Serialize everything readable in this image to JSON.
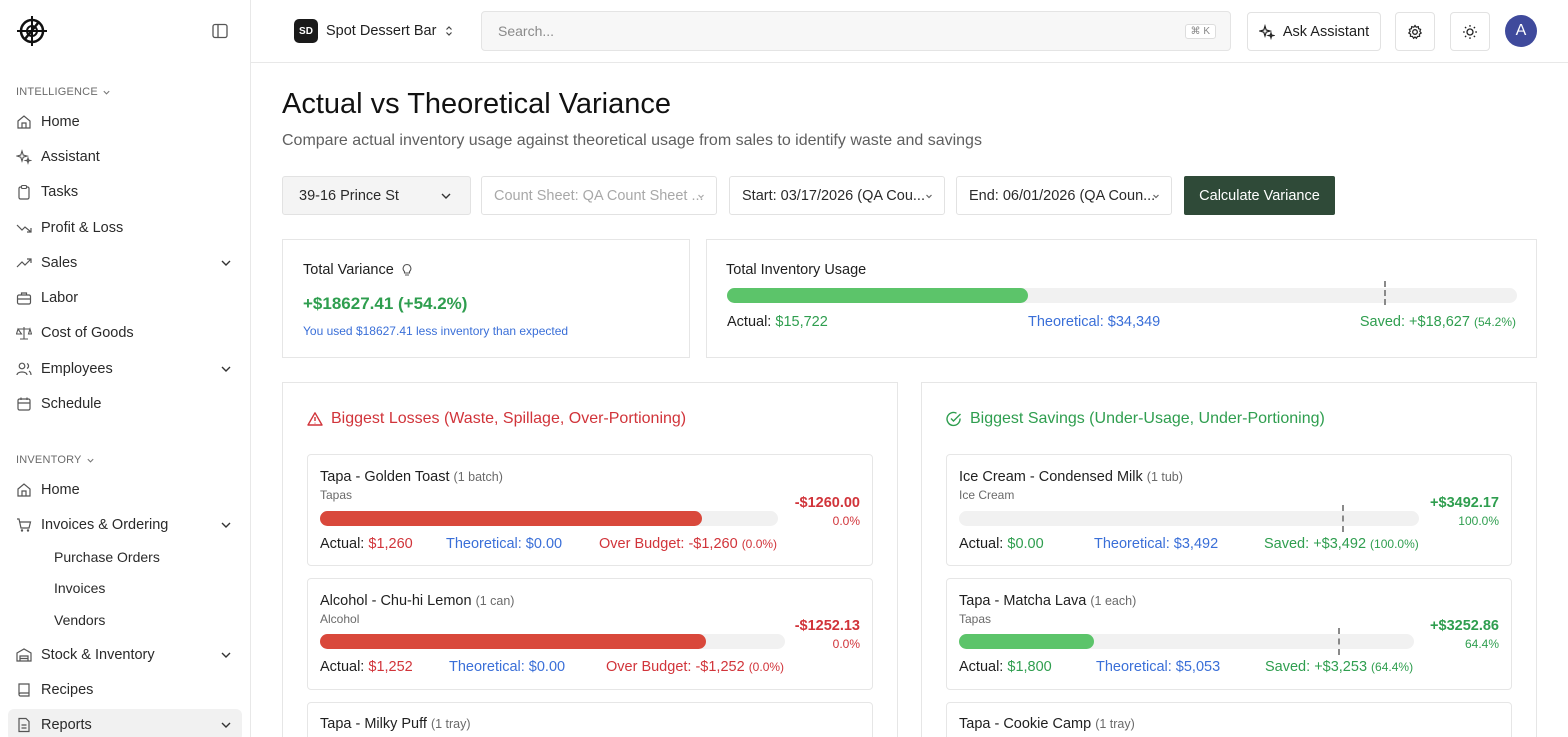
{
  "sidebar": {
    "sections": [
      {
        "label": "INTELLIGENCE"
      },
      {
        "label": "INVENTORY"
      }
    ],
    "intelligence_items": [
      {
        "label": "Home",
        "icon": "home-icon"
      },
      {
        "label": "Assistant",
        "icon": "sparkle-icon"
      },
      {
        "label": "Tasks",
        "icon": "clipboard-icon"
      },
      {
        "label": "Profit & Loss",
        "icon": "trend-down-icon"
      },
      {
        "label": "Sales",
        "icon": "trend-up-icon"
      },
      {
        "label": "Labor",
        "icon": "briefcase-icon"
      },
      {
        "label": "Cost of Goods",
        "icon": "scale-icon"
      },
      {
        "label": "Employees",
        "icon": "users-icon"
      },
      {
        "label": "Schedule",
        "icon": "calendar-icon"
      }
    ],
    "inventory_items": [
      {
        "label": "Home",
        "icon": "home-icon"
      },
      {
        "label": "Invoices & Ordering",
        "icon": "cart-icon"
      },
      {
        "label": "Stock & Inventory",
        "icon": "warehouse-icon"
      },
      {
        "label": "Recipes",
        "icon": "book-icon"
      },
      {
        "label": "Reports",
        "icon": "report-icon"
      }
    ],
    "sub_items": [
      "Purchase Orders",
      "Invoices",
      "Vendors"
    ]
  },
  "topbar": {
    "org_badge": "SD",
    "org_name": "Spot Dessert Bar",
    "search_placeholder": "Search...",
    "search_shortcut": "⌘ K",
    "ask_label": "Ask Assistant",
    "avatar_initial": "A"
  },
  "page": {
    "title": "Actual vs Theoretical Variance",
    "subtitle": "Compare actual inventory usage against theoretical usage from sales to identify waste and savings"
  },
  "filters": {
    "location": "39-16 Prince St",
    "count_sheet": "Count Sheet: QA Count Sheet ...",
    "start": "Start: 03/17/2026 (QA Cou...",
    "end": "End: 06/01/2026 (QA Coun...",
    "calculate_label": "Calculate Variance"
  },
  "total_variance": {
    "title": "Total Variance",
    "value": "+$18627.41 (+54.2%)",
    "note": "You used $18627.41 less inventory than expected"
  },
  "inventory_usage": {
    "title": "Total Inventory Usage",
    "actual_label": "Actual:",
    "actual_value": "$15,722",
    "theoretical_label": "Theoretical:",
    "theoretical_value": "$34,349",
    "saved_label": "Saved:",
    "saved_value": "+$18,627",
    "saved_pct": "(54.2%)",
    "fill_fraction": 0.381,
    "marker_fraction": 0.832
  },
  "losses": {
    "title": "Biggest Losses (Waste, Spillage, Over-Portioning)",
    "items": [
      {
        "name": "Tapa - Golden Toast",
        "unit": "(1 batch)",
        "category": "Tapas",
        "amount": "-$1260.00",
        "pct": "0.0%",
        "actual": "$1,260",
        "theoretical": "$0.00",
        "delta_label": "Over Budget:",
        "delta": "-$1,260",
        "delta_pct": "(0.0%)",
        "fill_fraction": 0.834
      },
      {
        "name": "Alcohol - Chu-hi Lemon",
        "unit": "(1 can)",
        "category": "Alcohol",
        "amount": "-$1252.13",
        "pct": "0.0%",
        "actual": "$1,252",
        "theoretical": "$0.00",
        "delta_label": "Over Budget:",
        "delta": "-$1,252",
        "delta_pct": "(0.0%)",
        "fill_fraction": 0.83
      },
      {
        "name": "Tapa - Milky Puff",
        "unit": "(1 tray)"
      }
    ]
  },
  "savings": {
    "title": "Biggest Savings (Under-Usage, Under-Portioning)",
    "items": [
      {
        "name": "Ice Cream - Condensed Milk",
        "unit": "(1 tub)",
        "category": "Ice Cream",
        "amount": "+$3492.17",
        "pct": "100.0%",
        "actual": "$0.00",
        "theoretical": "$3,492",
        "delta_label": "Saved:",
        "delta": "+$3,492",
        "delta_pct": "(100.0%)",
        "fill_fraction": 0.0,
        "marker_fraction": 0.833
      },
      {
        "name": "Tapa - Matcha Lava",
        "unit": "(1 each)",
        "category": "Tapas",
        "amount": "+$3252.86",
        "pct": "64.4%",
        "actual": "$1,800",
        "theoretical": "$5,053",
        "delta_label": "Saved:",
        "delta": "+$3,253",
        "delta_pct": "(64.4%)",
        "fill_fraction": 0.297,
        "marker_fraction": 0.833
      },
      {
        "name": "Tapa - Cookie Camp",
        "unit": "(1 tray)"
      }
    ]
  },
  "colors": {
    "green": "#5cc46a",
    "red": "#d9483b",
    "blue": "#3a6fd8",
    "dark_button": "#2f4a38"
  }
}
